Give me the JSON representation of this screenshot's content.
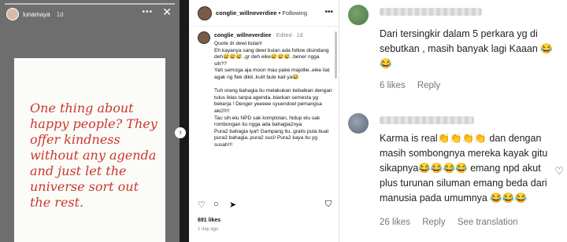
{
  "story": {
    "username": "lunamaya",
    "time": "1d",
    "quote": "One thing about happy people? They offer kindness without any agenda and just let the universe sort out the rest."
  },
  "post": {
    "username": "conglie_willneverdiee",
    "follow": "Following",
    "comment": {
      "username": "conglie_willneverdiee",
      "edited": "Edited",
      "time": "1d",
      "text": "Quote dr dewi bulan!\nEh kayanya sang dewi bulan ada follow disindang deh😅😅😅..gr deh eike😅😅😅..bener ngga sih??\nYah semoga aja moon mau pake majollie..eike liat agak ng flek dikit..kulit bule kali ya😂\n\nTuh orang bahagia itu melakukan kebaikan dengan tulus iklas tanpa agenda..biarkan semesta yg bekerja ! Denger yeeeee syuendoel pemangsa aki2!!!!\nTau sih elu NPD sak komplotan, hidup elu sak rombongan itu ngga ada bahagia2nya\nPura2 bahagia iya!! Gampang itu, gratis pula buat pura2 bahagia..pura2 suci! Pura2 kaya itu yg susah!!!"
    },
    "likes": "691 likes",
    "ago": "1 day ago"
  },
  "comments": [
    {
      "text": "Dari tersingkir dalam 5 perkara yg di sebutkan , masih banyak lagi Kaaan 😂😂",
      "likes": "6 likes",
      "reply": "Reply"
    },
    {
      "text": "Karma is real👏👏👏👏 dan dengan masih sombongnya mereka kayak gitu sikapnya😂😂😂😂 emang npd akut plus turunan siluman emang beda dari manusia pada umumnya 😂😂😂",
      "likes": "26 likes",
      "reply": "Reply",
      "translation": "See translation"
    }
  ],
  "icons": {
    "more": "more-icon",
    "close": "close-icon",
    "heart": "heart-icon",
    "comment": "comment-icon",
    "share": "share-icon",
    "save": "bookmark-icon"
  },
  "colors": {
    "quote_red": "#c8382d",
    "story_bg": "#6e6e6e"
  }
}
